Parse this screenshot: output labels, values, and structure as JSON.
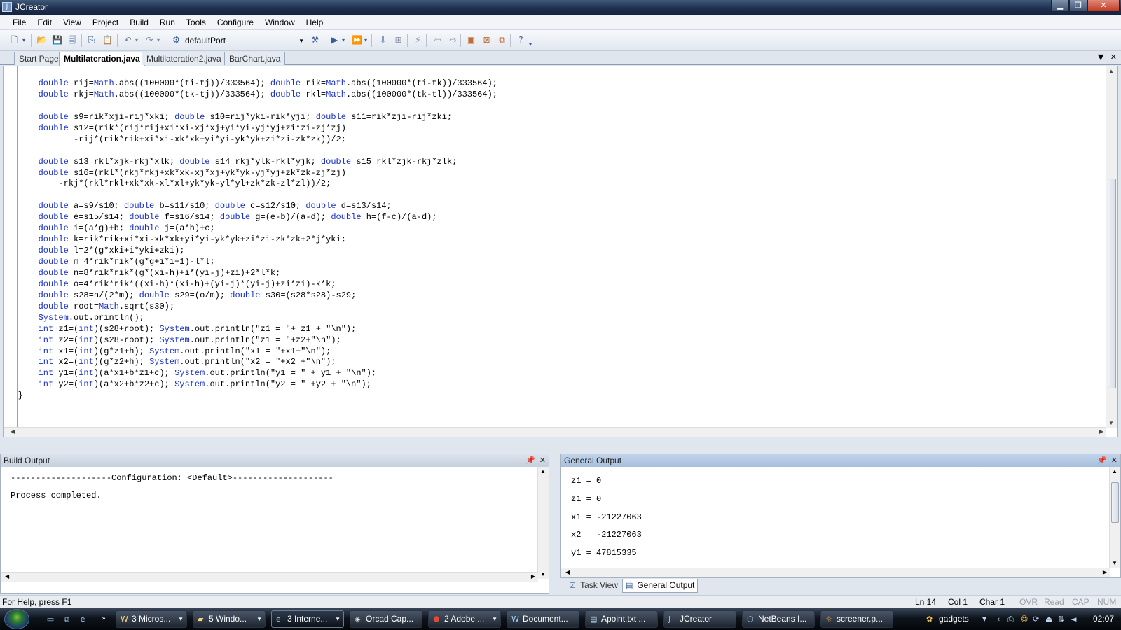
{
  "window": {
    "title": "JCreator"
  },
  "menu": [
    "File",
    "Edit",
    "View",
    "Project",
    "Build",
    "Run",
    "Tools",
    "Configure",
    "Window",
    "Help"
  ],
  "toolbar": {
    "config_combo": "defaultPort"
  },
  "tabs": [
    {
      "label": "Start Page",
      "active": false
    },
    {
      "label": "Multilateration.java",
      "active": true
    },
    {
      "label": "Multilateration2.java",
      "active": false
    },
    {
      "label": "BarChart.java",
      "active": false
    }
  ],
  "editor": {
    "lines": [
      "        double rij=Math.abs((100000*(ti-tj))/333564); double rik=Math.abs((100000*(ti-tk))/333564);",
      "        double rkj=Math.abs((100000*(tk-tj))/333564); double rkl=Math.abs((100000*(tk-tl))/333564);",
      "",
      "        double s9=rik*xji-rij*xki; double s10=rij*yki-rik*yji; double s11=rik*zji-rij*zki;",
      "        double s12=(rik*(rij*rij+xi*xi-xj*xj+yi*yi-yj*yj+zi*zi-zj*zj)",
      "               -rij*(rik*rik+xi*xi-xk*xk+yi*yi-yk*yk+zi*zi-zk*zk))/2;",
      "",
      "        double s13=rkl*xjk-rkj*xlk; double s14=rkj*ylk-rkl*yjk; double s15=rkl*zjk-rkj*zlk;",
      "        double s16=(rkl*(rkj*rkj+xk*xk-xj*xj+yk*yk-yj*yj+zk*zk-zj*zj)",
      "            -rkj*(rkl*rkl+xk*xk-xl*xl+yk*yk-yl*yl+zk*zk-zl*zl))/2;",
      "",
      "        double a=s9/s10; double b=s11/s10; double c=s12/s10; double d=s13/s14;",
      "        double e=s15/s14; double f=s16/s14; double g=(e-b)/(a-d); double h=(f-c)/(a-d);",
      "        double i=(a*g)+b; double j=(a*h)+c;",
      "        double k=rik*rik+xi*xi-xk*xk+yi*yi-yk*yk+zi*zi-zk*zk+2*j*yki;",
      "        double l=2*(g*xki+i*yki+zki);",
      "        double m=4*rik*rik*(g*g+i*i+1)-l*l;",
      "        double n=8*rik*rik*(g*(xi-h)+i*(yi-j)+zi)+2*l*k;",
      "        double o=4*rik*rik*((xi-h)*(xi-h)+(yi-j)*(yi-j)+zi*zi)-k*k;",
      "        double s28=n/(2*m); double s29=(o/m); double s30=(s28*s28)-s29;",
      "        double root=Math.sqrt(s30);",
      "        System.out.println();",
      "        int z1=(int)(s28+root); System.out.println(\"z1 = \"+ z1 + \"\\n\");",
      "        int z2=(int)(s28-root); System.out.println(\"z1 = \"+z2+\"\\n\");",
      "        int x1=(int)(g*z1+h); System.out.println(\"x1 = \"+x1+\"\\n\");",
      "        int x2=(int)(g*z2+h); System.out.println(\"x2 = \"+x2 +\"\\n\");",
      "        int y1=(int)(a*x1+b*z1+c); System.out.println(\"y1 = \" + y1 + \"\\n\");",
      "        int y2=(int)(a*x2+b*z2+c); System.out.println(\"y2 = \" +y2 + \"\\n\");",
      "    }"
    ]
  },
  "build_output": {
    "title": "Build Output",
    "lines": [
      "--------------------Configuration: <Default>--------------------",
      "Process completed."
    ]
  },
  "general_output": {
    "title": "General Output",
    "lines": [
      "z1 = 0",
      "z1 = 0",
      "x1 = -21227063",
      "x2 = -21227063",
      "y1 = 47815335"
    ]
  },
  "bottom_tabs": [
    {
      "label": "Task View",
      "active": false
    },
    {
      "label": "General Output",
      "active": true
    }
  ],
  "statusbar": {
    "help": "For Help, press F1",
    "ln": "Ln 14",
    "col": "Col 1",
    "char": "Char 1",
    "ovr": "OVR",
    "read": "Read",
    "cap": "CAP",
    "num": "NUM"
  },
  "taskbar": {
    "items": [
      {
        "label": "3 Micros...",
        "active": false
      },
      {
        "label": "5 Windo...",
        "active": false
      },
      {
        "label": "3 Interne...",
        "active": true
      },
      {
        "label": "Orcad Cap...",
        "active": false
      },
      {
        "label": "2 Adobe ...",
        "active": false
      },
      {
        "label": "Document...",
        "active": false
      },
      {
        "label": "Apoint.txt ...",
        "active": false
      },
      {
        "label": "JCreator",
        "active": false
      },
      {
        "label": "NetBeans I...",
        "active": false
      },
      {
        "label": "screener.p...",
        "active": false
      }
    ],
    "gadgets": "gadgets",
    "clock": "02:07"
  }
}
